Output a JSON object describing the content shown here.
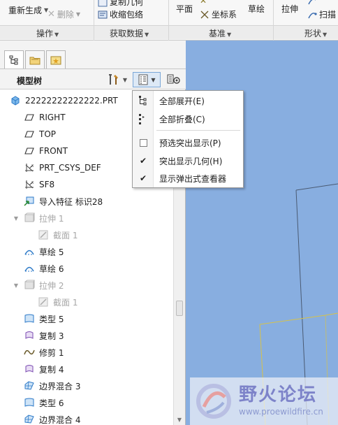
{
  "ribbon": {
    "regenerate": "重新生成",
    "delete": "删除",
    "copy_geom_partial": "复制几何",
    "shrinkwrap": "收缩包络",
    "plane": "平面",
    "csys": "坐标系",
    "sketch": "草绘",
    "extrude": "拉伸",
    "sweep": "扫描",
    "groups": {
      "operations": "操作",
      "get_data": "获取数据",
      "datum": "基准",
      "shapes": "形状"
    }
  },
  "panel": {
    "title": "模型树",
    "tabs": [
      "model-tree",
      "folder-browser",
      "favorites"
    ]
  },
  "tree": {
    "items": [
      {
        "label": "22222222222222.PRT",
        "icon": "part-icon",
        "dim": false
      },
      {
        "label": "RIGHT",
        "icon": "datum-plane-icon",
        "dim": false
      },
      {
        "label": "TOP",
        "icon": "datum-plane-icon",
        "dim": false
      },
      {
        "label": "FRONT",
        "icon": "datum-plane-icon",
        "dim": false
      },
      {
        "label": "PRT_CSYS_DEF",
        "icon": "csys-icon",
        "dim": false
      },
      {
        "label": "SF8",
        "icon": "csys-icon",
        "dim": false
      },
      {
        "label": "导入特征 标识28",
        "icon": "import-feature-icon",
        "dim": false
      },
      {
        "label": "拉伸 1",
        "icon": "extrude-icon",
        "dim": true
      },
      {
        "label": "截面 1",
        "icon": "section-icon",
        "dim": true
      },
      {
        "label": "草绘 5",
        "icon": "sketch-icon",
        "dim": false
      },
      {
        "label": "草绘 6",
        "icon": "sketch-icon",
        "dim": false
      },
      {
        "label": "拉伸 2",
        "icon": "extrude-icon",
        "dim": true
      },
      {
        "label": "截面 1",
        "icon": "section-icon",
        "dim": true
      },
      {
        "label": "类型 5",
        "icon": "surface-icon",
        "dim": false
      },
      {
        "label": "复制 3",
        "icon": "copy-icon",
        "dim": false
      },
      {
        "label": "修剪 1",
        "icon": "trim-icon",
        "dim": false
      },
      {
        "label": "复制 4",
        "icon": "copy-icon",
        "dim": false
      },
      {
        "label": "边界混合 3",
        "icon": "boundary-blend-icon",
        "dim": false
      },
      {
        "label": "类型 6",
        "icon": "surface-icon",
        "dim": false
      },
      {
        "label": "边界混合 4",
        "icon": "boundary-blend-icon",
        "dim": false
      }
    ]
  },
  "menu": {
    "expand_all": "全部展开(E)",
    "collapse_all": "全部折叠(C)",
    "preselect_highlight": "预选突出显示(P)",
    "highlight_geometry": "突出显示几何(H)",
    "show_popup_viewer": "显示弹出式查看器",
    "checked": {
      "preselect_highlight": false,
      "highlight_geometry": true,
      "show_popup_viewer": true
    }
  },
  "watermark": {
    "title": "野火论坛",
    "url": "www.proewildfire.cn"
  },
  "colors": {
    "viewport": "#88aee0",
    "edge_dark": "#4a5a72",
    "edge_yellow": "#d6c24a",
    "tree_icon_blue": "#2d7ac8"
  }
}
